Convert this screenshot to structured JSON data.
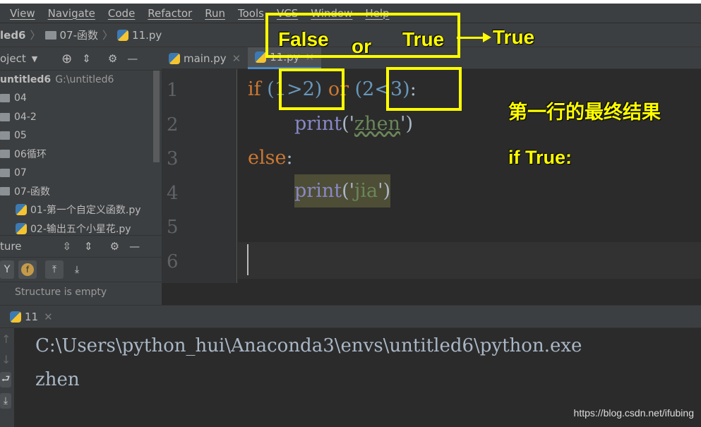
{
  "menu": [
    "View",
    "Navigate",
    "Code",
    "Refactor",
    "Run",
    "Tools",
    "VCS",
    "Window",
    "Help"
  ],
  "breadcrumb": {
    "project": "led6",
    "folder": "07-函数",
    "file": "11.py"
  },
  "project_panel": {
    "title": "oject",
    "root_name": "untitled6",
    "root_path": "G:\\untitled6",
    "items": [
      {
        "label": "04",
        "type": "folder"
      },
      {
        "label": "04-2",
        "type": "folder"
      },
      {
        "label": "05",
        "type": "folder"
      },
      {
        "label": "06循环",
        "type": "folder"
      },
      {
        "label": "07",
        "type": "folder"
      },
      {
        "label": "07-函数",
        "type": "folder"
      },
      {
        "label": "01-第一个自定义函数.py",
        "type": "file"
      },
      {
        "label": "02-输出五个小星花.py",
        "type": "file"
      }
    ]
  },
  "structure_panel": {
    "title": "ture",
    "empty_text": "Structure is empty"
  },
  "editor_tabs": [
    {
      "label": "main.py",
      "active": false
    },
    {
      "label": "11.py",
      "active": true
    }
  ],
  "code": {
    "line_numbers": [
      "1",
      "2",
      "3",
      "4",
      "5",
      "6"
    ],
    "l1": {
      "kw": "if",
      "a": "(1>2)",
      "or": "or",
      "b": "(2<3)",
      "colon": ":"
    },
    "l2": {
      "fn": "print",
      "open": "('",
      "str": "zhen",
      "close": "')"
    },
    "l3": {
      "kw": "else",
      "colon": ":"
    },
    "l4": {
      "fn": "print",
      "open": "('",
      "str": "jia",
      "close": "')"
    }
  },
  "run": {
    "tab_label": "11",
    "output": [
      "C:\\Users\\python_hui\\Anaconda3\\envs\\untitled6\\python.exe",
      "zhen"
    ]
  },
  "annotations": {
    "false": "False",
    "or": "or",
    "true": "True",
    "result": "True",
    "note1": "第一行的最终结果",
    "note2": "if True:"
  },
  "watermark": "https://blog.csdn.net/ifubing",
  "colors": {
    "keyword": "#cc7832",
    "number": "#6897bb",
    "builtin": "#8888c6",
    "string": "#6a8759",
    "annotation": "#ffff00"
  }
}
